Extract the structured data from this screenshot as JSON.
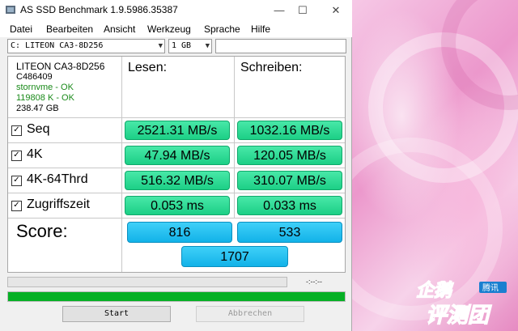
{
  "window": {
    "title": "AS SSD Benchmark 1.9.5986.35387",
    "minimize": "—",
    "maximize": "☐",
    "close": "✕"
  },
  "menu": [
    "Datei",
    "Bearbeiten",
    "Ansicht",
    "Werkzeug",
    "Sprache",
    "Hilfe"
  ],
  "controls": {
    "drive_select": "C: LITEON CA3-8D256",
    "size_select": "1 GB",
    "extra_input": ""
  },
  "drive_info": {
    "model": "LITEON CA3-8D256",
    "firmware": "C486409",
    "driver": "stornvme - OK",
    "alignment": "119808 K - OK",
    "capacity": "238.47 GB"
  },
  "columns": {
    "read": "Lesen:",
    "write": "Schreiben:"
  },
  "tests": [
    {
      "name": "Seq",
      "checked": true,
      "read": "2521.31 MB/s",
      "write": "1032.16 MB/s"
    },
    {
      "name": "4K",
      "checked": true,
      "read": "47.94 MB/s",
      "write": "120.05 MB/s"
    },
    {
      "name": "4K-64Thrd",
      "checked": true,
      "read": "516.32 MB/s",
      "write": "310.07 MB/s"
    },
    {
      "name": "Zugriffszeit",
      "checked": true,
      "read": "0.053 ms",
      "write": "0.033 ms"
    }
  ],
  "score": {
    "label": "Score:",
    "read": "816",
    "write": "533",
    "total": "1707"
  },
  "progress": {
    "timer": "-:--:--",
    "overall_fraction": 1.0
  },
  "buttons": {
    "start": "Start",
    "abort": "Abbrechen"
  },
  "watermark": {
    "text_top": "企鹅",
    "text_bottom": "评测团",
    "badge": "腾讯"
  },
  "colors": {
    "result_green": "#1ccf86",
    "score_blue": "#12b2e8",
    "progress_green": "#06b025",
    "ok_text": "#1a8a1a"
  }
}
